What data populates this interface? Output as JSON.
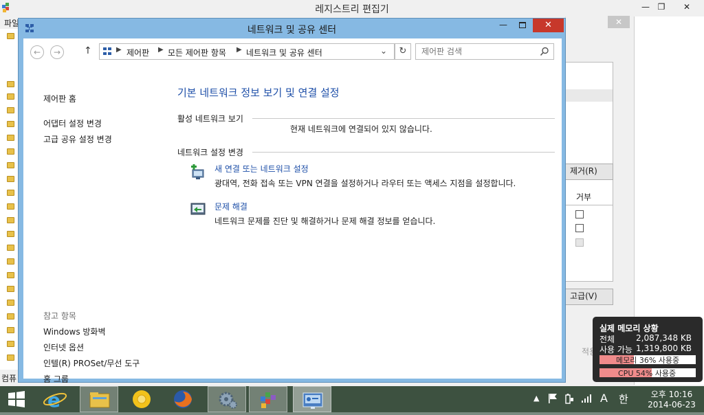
{
  "registry": {
    "title": "레지스트리 편집기",
    "menu_label": "파일",
    "status": "컴퓨",
    "minimize": "—",
    "maximize": "❐",
    "close": "✕"
  },
  "dialog": {
    "remove_btn": "제거(R)",
    "deny_label": "거부",
    "advanced_btn": "고급(V)",
    "apply_fragment": "적용",
    "close": "✕"
  },
  "network": {
    "title": "네트워크 및 공유 센터",
    "minimize": "—",
    "maximize": "☐",
    "close": "✕",
    "breadcrumb": [
      "제어판",
      "모든 제어판 항목",
      "네트워크 및 공유 센터"
    ],
    "search_placeholder": "제어판 검색",
    "sidebar": {
      "home": "제어판 홈",
      "links": [
        "어댑터 설정 변경",
        "고급 공유 설정 변경"
      ],
      "see_also": "참고 항목",
      "see_also_links": [
        "Windows 방화벽",
        "인터넷 옵션",
        "인텔(R) PROSet/무선 도구",
        "홈 그룹"
      ]
    },
    "heading": "기본 네트워크 정보 보기 및 연결 설정",
    "active_section": "활성 네트워크 보기",
    "not_connected": "현재 네트워크에 연결되어 있지 않습니다.",
    "change_section": "네트워크 설정 변경",
    "tasks": [
      {
        "title": "새 연결 또는 네트워크 설정",
        "desc": "광대역, 전화 접속 또는 VPN 연결을 설정하거나 라우터 또는 액세스 지점을 설정합니다."
      },
      {
        "title": "문제 해결",
        "desc": "네트워크 문제를 진단 및 해결하거나 문제 해결 정보를 얻습니다."
      }
    ]
  },
  "memory_gadget": {
    "title": "실제 메모리 상황",
    "total_label": "전체",
    "total_value": "2,087,348 KB",
    "avail_label": "사용 가능",
    "avail_value": "1,319,800 KB",
    "mem_bar_text": "메모리 36% 사용중",
    "mem_percent": 36,
    "cpu_bar_text": "CPU 54% 사용중",
    "cpu_percent": 54
  },
  "taskbar": {
    "apps": [
      "start-button",
      "internet-explorer",
      "file-explorer",
      "chrome",
      "firefox",
      "settings",
      "registry-editor",
      "network-center"
    ],
    "tray_ime_a": "A",
    "tray_ime_han": "한",
    "time": "오후 10:16",
    "date": "2014-06-23"
  }
}
